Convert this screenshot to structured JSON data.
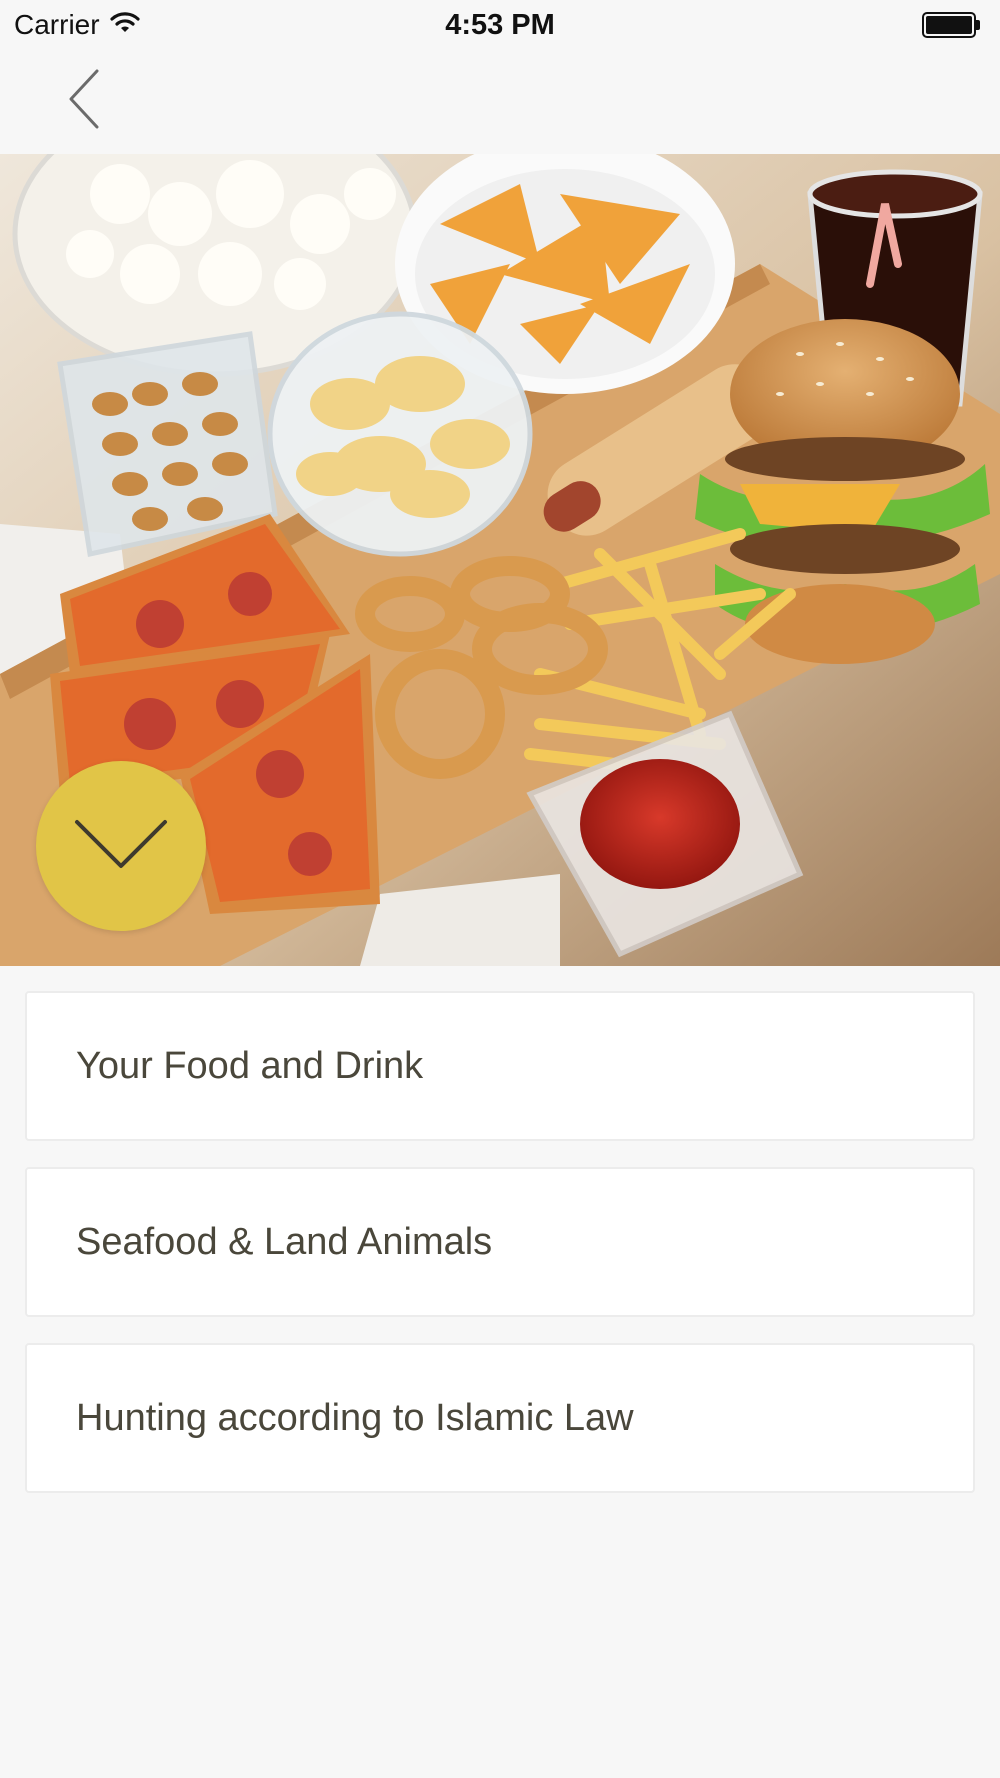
{
  "status_bar": {
    "carrier": "Carrier",
    "time": "4:53 PM"
  },
  "nav": {
    "back_icon": "chevron-left-icon"
  },
  "hero": {
    "expand_icon": "chevron-down-icon",
    "expand_button_color": "#e1c547"
  },
  "menu": {
    "items": [
      {
        "label": "Your Food and Drink"
      },
      {
        "label": "Seafood & Land Animals"
      },
      {
        "label": "Hunting according to Islamic Law"
      }
    ]
  },
  "colors": {
    "background": "#f7f7f7",
    "card": "#ffffff",
    "text": "#4a473b",
    "accent": "#e1c547"
  }
}
